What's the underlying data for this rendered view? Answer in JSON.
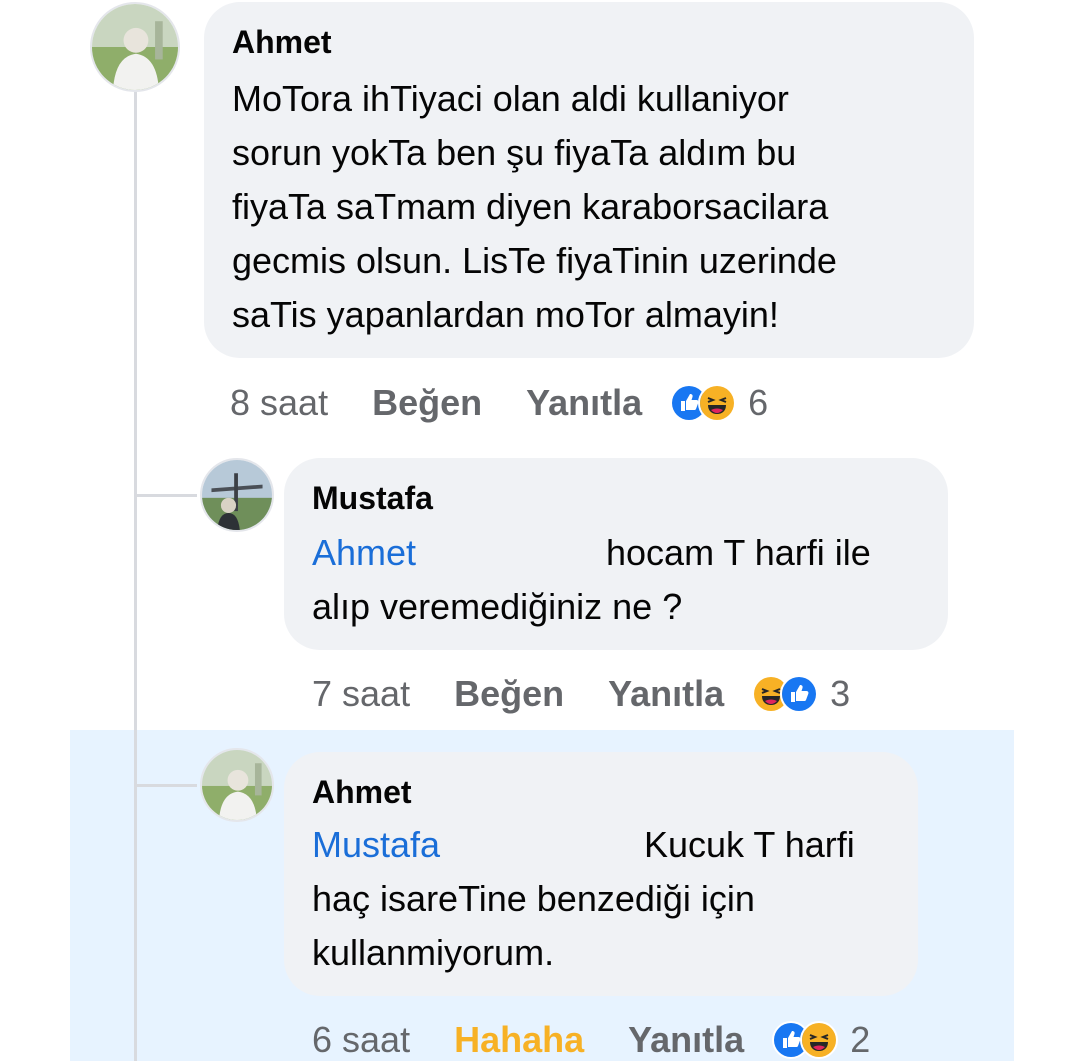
{
  "comments": [
    {
      "author": "Ahmet",
      "lines": [
        "MoTora ihTiyaci olan aldi kullaniyor",
        "sorun yokTa ben şu fiyaTa aldım bu",
        "fiyaTa saTmam diyen karaborsacilara",
        "gecmis olsun. LisTe fiyaTinin uzerinde",
        "saTis yapanlardan moTor almayin!"
      ],
      "time": "8 saat",
      "like_label": "Beğen",
      "reply_label": "Yanıtla",
      "reactions": [
        "like-icon",
        "haha-icon"
      ],
      "reaction_count": "6"
    },
    {
      "author": "Mustafa",
      "mention": "Ahmet",
      "first_line": "hocam T harfi ile",
      "lines": [
        "alıp veremediğiniz ne ?"
      ],
      "time": "7 saat",
      "like_label": "Beğen",
      "reply_label": "Yanıtla",
      "reactions": [
        "haha-icon",
        "like-icon"
      ],
      "reaction_count": "3"
    },
    {
      "author": "Ahmet",
      "mention": "Mustafa",
      "first_line": "Kucuk T harfi",
      "lines": [
        "haç isareTine benzediği için",
        "kullanmiyorum."
      ],
      "time": "6 saat",
      "like_label": "Hahaha",
      "reply_label": "Yanıtla",
      "reactions": [
        "like-icon",
        "haha-icon"
      ],
      "reaction_count": "2"
    }
  ],
  "colors": {
    "mention": "#1a6ed8",
    "bubble": "#f0f2f5",
    "highlight": "#e7f3ff",
    "haha_active": "#f7b125",
    "meta": "#65676b"
  }
}
